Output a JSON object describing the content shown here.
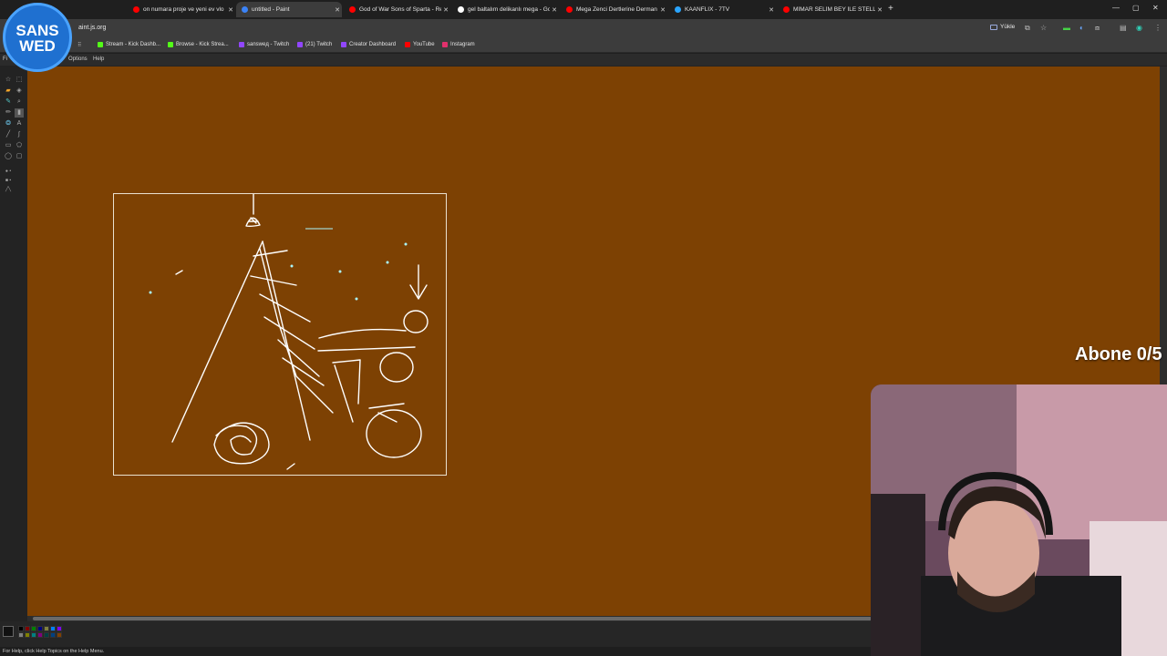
{
  "browser": {
    "tabs": [
      {
        "title": "on numara proje ve yeni ev vlo",
        "icon": "youtube-icon",
        "color": "#ff0000"
      },
      {
        "title": "untitled - Paint",
        "icon": "paint-icon",
        "color": "#3b83f7",
        "active": true
      },
      {
        "title": "God of War Sons of Sparta - Re",
        "icon": "youtube-icon",
        "color": "#ff0000"
      },
      {
        "title": "gel baltalım delikanlı mega - Go",
        "icon": "google-icon",
        "color": "#ffffff"
      },
      {
        "title": "Mega Zenci Dertlerine Derman",
        "icon": "youtube-icon",
        "color": "#ff0000"
      },
      {
        "title": "KAANFLIX - 7TV",
        "icon": "7tv-icon",
        "color": "#2aa5ff"
      },
      {
        "title": "MİMAR SELİM BEY İLE STELLA",
        "icon": "youtube-icon",
        "color": "#ff0000"
      }
    ],
    "address": "aint.js.org",
    "yukle_label": "Yükle",
    "bookmarks": [
      {
        "label": "Stream - Kick Dashb...",
        "color": "#53fc18"
      },
      {
        "label": "Browse - Kick Strea...",
        "color": "#53fc18"
      },
      {
        "label": "sansweд - Twitch",
        "color": "#9146ff"
      },
      {
        "label": "(21) Twitch",
        "color": "#9146ff"
      },
      {
        "label": "Creator Dashboard",
        "color": "#9146ff"
      },
      {
        "label": "YouTube",
        "color": "#ff0000"
      },
      {
        "label": "Instagram",
        "color": "#e1306c"
      }
    ]
  },
  "paint": {
    "menus": [
      "Fi",
      "Options",
      "Help"
    ],
    "status": "For Help, click Help Topics on the Help Menu.",
    "canvas_color": "#7d4103",
    "palette": [
      "#000000",
      "#808080",
      "#800000",
      "#808000",
      "#008000",
      "#008080",
      "#000080",
      "#800080",
      "#808040",
      "#004040",
      "#0080ff",
      "#004080",
      "#8000ff",
      "#804000"
    ]
  },
  "overlay": {
    "logo_line1": "SANS",
    "logo_line2": "WED",
    "abone": "Abone 0/5"
  }
}
